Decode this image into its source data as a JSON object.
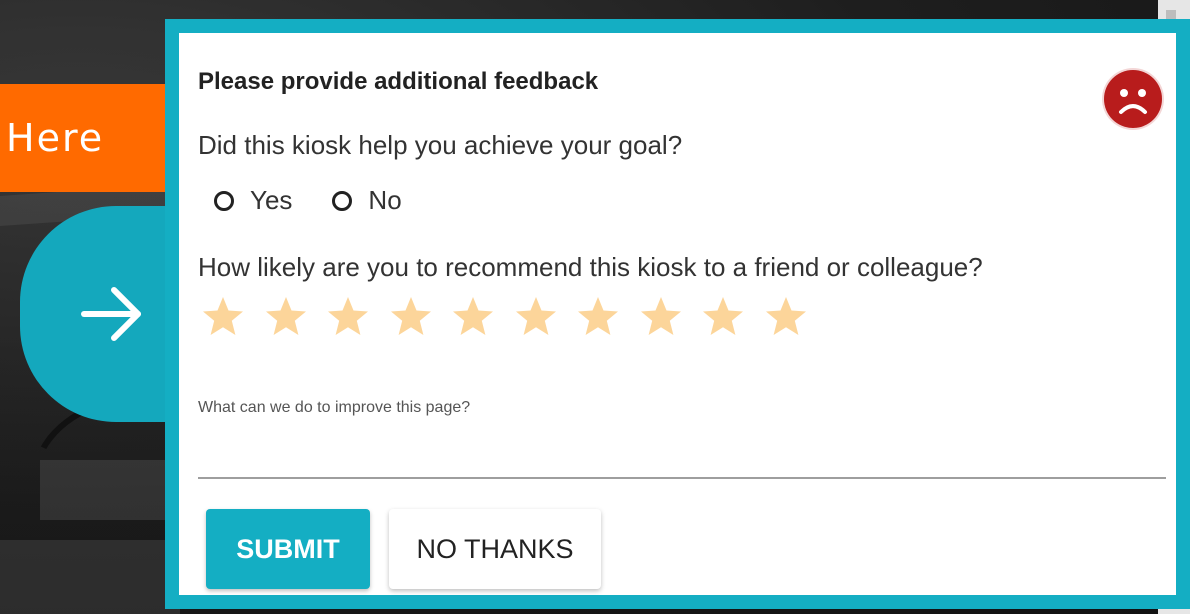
{
  "background": {
    "tab_text": "Here",
    "arrow_icon": "arrow-right-icon"
  },
  "dialog": {
    "title": "Please provide additional feedback",
    "sentiment_icon": "sad-face-icon",
    "question_goal": "Did this kiosk help you achieve your goal?",
    "options": [
      "Yes",
      "No"
    ],
    "question_recommend": "How likely are you to recommend this kiosk to a friend or colleague?",
    "rating": {
      "max": 10,
      "selected": 0
    },
    "improve_label": "What can we do to improve this page?",
    "improve_value": "",
    "submit_label": "SUBMIT",
    "no_thanks_label": "NO THANKS"
  },
  "colors": {
    "accent": "#14aec3",
    "orange": "#ff6a00",
    "star": "#fcd59a",
    "sad": "#b81c1c"
  }
}
